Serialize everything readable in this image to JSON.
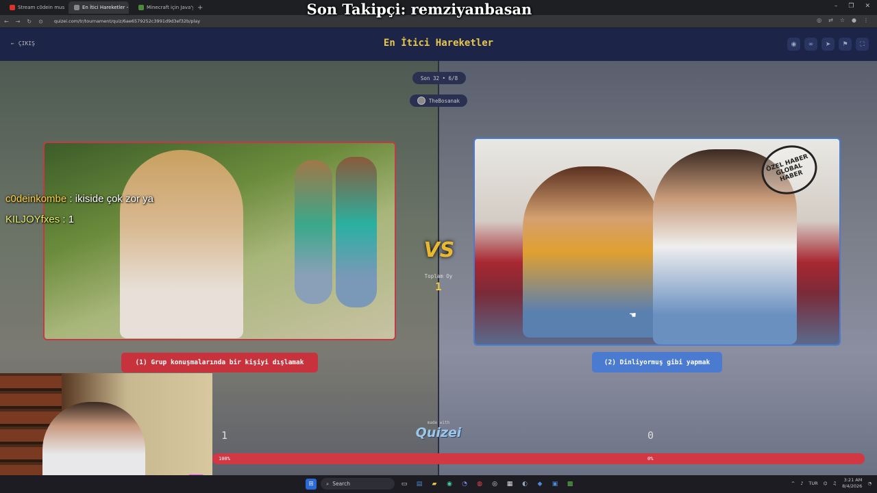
{
  "overlay_title": "Son Takipçi: remziyanbasan",
  "browser": {
    "tabs": [
      {
        "label": "Stream c0dein music |",
        "color": "#e0302a",
        "active": false
      },
      {
        "label": "En İtici Hareketler - Tir",
        "color": "#888888",
        "active": true
      },
      {
        "label": "Minecraft için Java'yı in",
        "color": "#4a8a3a",
        "active": false
      }
    ],
    "new_tab": "+",
    "url": "quizei.com/tr/tournament/quiz/6ae6579252c3991d9d3ef32b/play",
    "window_controls": [
      "–",
      "❐",
      "✕"
    ]
  },
  "quiz": {
    "exit_label": "ÇIKIŞ",
    "title": "En İtici Hareketler",
    "round_pill": "Son 32 • 6/8",
    "user_pill": "TheBosanak",
    "vs": "VS",
    "total_label": "Toplam Oy",
    "total_value": "1",
    "left_option": "(1) Grup konuşmalarında bir kişiyi dışlamak",
    "right_option": "(2) Dinliyormuş gibi yapmak",
    "stamp_text": "ÖZEL HABER GLOBAL HABER",
    "made_with": "made with",
    "made_logo": "Quizei",
    "left_score": "1",
    "right_score": "0",
    "left_percent_label": "100%",
    "right_percent_label": "0%",
    "left_share": 1.0,
    "colors": {
      "accent": "#e8c74a",
      "left": "#c8323c",
      "right": "#4a7bd0"
    }
  },
  "chat": [
    {
      "user": "c0deinkombe",
      "message": " : ikiside çok zor ya"
    },
    {
      "user": "KILJOYfxes",
      "message": " : 1"
    }
  ],
  "taskbar": {
    "search_placeholder": "Search",
    "lang": "TUR",
    "time": "3:21 AM",
    "date": "8/4/2026"
  }
}
